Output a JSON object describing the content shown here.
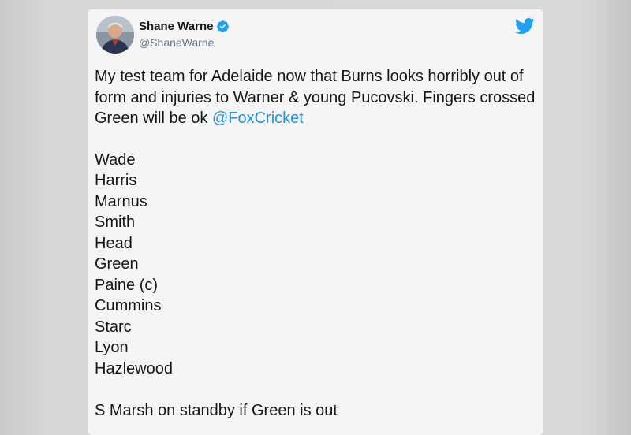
{
  "user": {
    "display_name": "Shane Warne",
    "handle": "@ShaneWarne",
    "verified": true,
    "avatar_icon": "profile-photo"
  },
  "brand": {
    "logo_icon": "twitter-bird-icon",
    "accent_color": "#1da1f2",
    "mention_color": "#1b95e0"
  },
  "tweet": {
    "text": "My test team for Adelaide now that Burns looks horribly out of form and injuries to Warner & young Pucovski. Fingers crossed Green will be ok ",
    "mention": "@FoxCricket",
    "players": [
      "Wade",
      "Harris",
      "Marnus",
      "Smith",
      "Head",
      "Green",
      "Paine (c)",
      "Cummins",
      "Starc",
      "Lyon",
      "Hazlewood"
    ],
    "standby_note": "S Marsh on standby if Green is out"
  }
}
